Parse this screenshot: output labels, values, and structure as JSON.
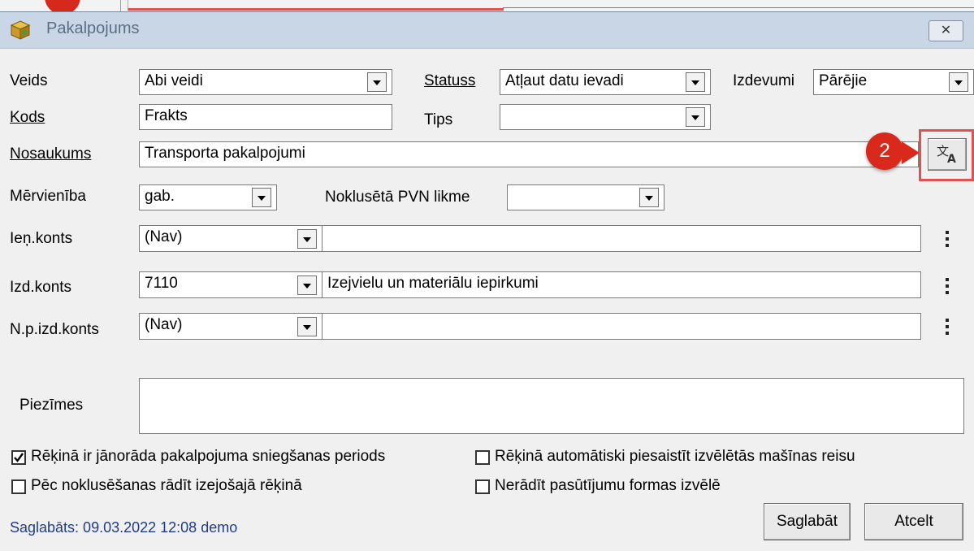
{
  "window": {
    "title": "Pakalpojums",
    "close_glyph": "✕"
  },
  "fields": {
    "veids": {
      "label": "Veids",
      "value": "Abi veidi"
    },
    "statuss": {
      "label": "Statuss",
      "value": "Atļaut datu ievadi"
    },
    "izdevumi": {
      "label": "Izdevumi",
      "value": "Pārējie"
    },
    "kods": {
      "label": "Kods",
      "value": "Frakts"
    },
    "tips": {
      "label": "Tips",
      "value": ""
    },
    "nosaukums": {
      "label": "Nosaukums",
      "value": "Transporta pakalpojumi"
    },
    "mervieniba": {
      "label": "Mērvienība",
      "value": "gab."
    },
    "pvn": {
      "label": "Noklusētā PVN likme",
      "value": ""
    },
    "ien_konts": {
      "label": "Ieņ.konts",
      "code": "(Nav)",
      "name": ""
    },
    "izd_konts": {
      "label": "Izd.konts",
      "code": "7110",
      "name": "Izejvielu un materiālu iepirkumi"
    },
    "np_izd_konts": {
      "label": "N.p.izd.konts",
      "code": "(Nav)",
      "name": ""
    },
    "piezimes": {
      "label": "Piezīmes",
      "value": ""
    }
  },
  "checkboxes": [
    {
      "label": "Rēķinā ir jānorāda pakalpojuma sniegšanas periods",
      "checked": true
    },
    {
      "label": "Rēķinā automātiski piesaistīt izvēlētās mašīnas reisu",
      "checked": false
    },
    {
      "label": "Pēc noklusēšanas rādīt izejošajā rēķinā",
      "checked": false
    },
    {
      "label": "Nerādīt pasūtījumu formas izvēlē",
      "checked": false
    }
  ],
  "footer": {
    "saved": "Saglabāts: 09.03.2022 12:08 demo",
    "save_label": "Saglabāt",
    "cancel_label": "Atcelt"
  },
  "annotation": {
    "badge": "2"
  },
  "icons": {
    "title": "package-icon",
    "translate": "translate-icon",
    "more": "vertical-dots-icon",
    "check": "checkmark-icon"
  },
  "colors": {
    "title_bar": "#c9d6e6",
    "badge": "#d9291d",
    "highlight": "#e05252",
    "saved_text": "#1f3c8c"
  }
}
